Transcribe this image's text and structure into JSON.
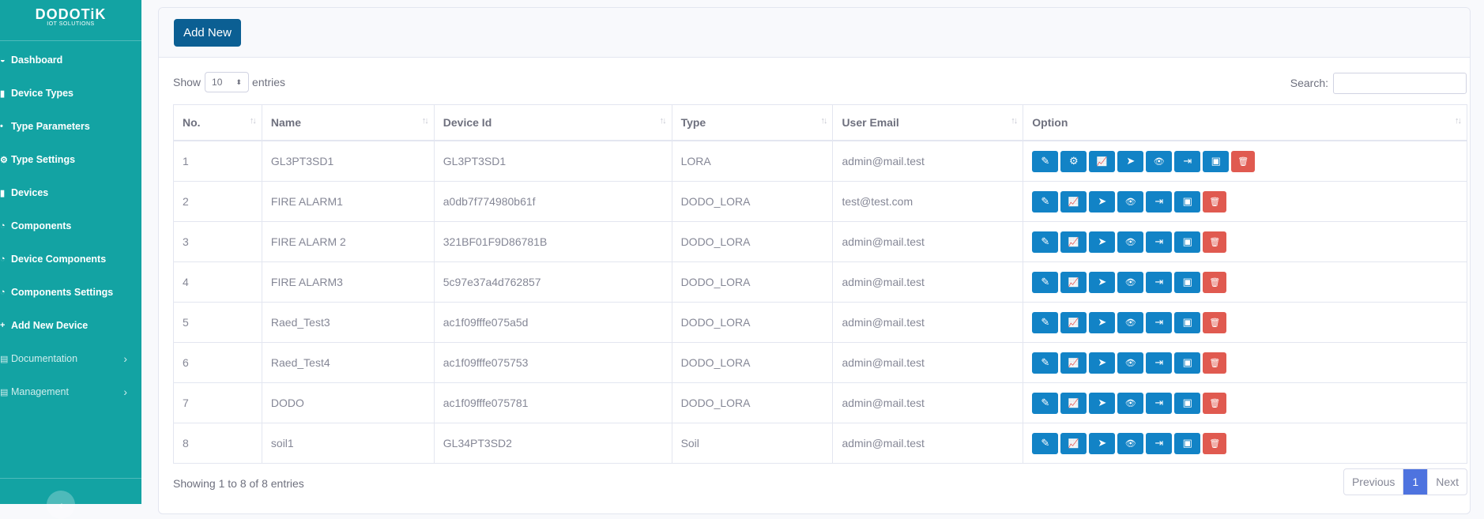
{
  "brand": {
    "name": "DODOTiK",
    "sub": "IOT SOLUTIONS"
  },
  "sidebar": {
    "items": [
      {
        "label": "Dashboard",
        "icon": "dashboard-icon"
      },
      {
        "label": "Device Types",
        "icon": "device-types-icon"
      },
      {
        "label": "Type Parameters",
        "icon": "type-parameters-icon"
      },
      {
        "label": "Type Settings",
        "icon": "gear-icon"
      },
      {
        "label": "Devices",
        "icon": "devices-icon"
      },
      {
        "label": "Components",
        "icon": "components-icon"
      },
      {
        "label": "Device Components",
        "icon": "device-components-icon"
      },
      {
        "label": "Components Settings",
        "icon": "components-settings-icon"
      },
      {
        "label": "Add New Device",
        "icon": "plus-icon"
      },
      {
        "label": "Documentation",
        "icon": "document-icon"
      },
      {
        "label": "Management",
        "icon": "management-icon"
      }
    ],
    "toggle_icon": "chevron-left-icon"
  },
  "toolbar": {
    "add_label": "Add New"
  },
  "table_controls": {
    "show_label": "Show",
    "entries_label": "entries",
    "page_size": "10",
    "search_label": "Search:",
    "search_value": ""
  },
  "table": {
    "headers": [
      "No.",
      "Name",
      "Device Id",
      "Type",
      "User Email",
      "Option"
    ],
    "rows": [
      {
        "no": "1",
        "name": "GL3PT3SD1",
        "device_id": "GL3PT3SD1",
        "type": "LORA",
        "email": "admin@mail.test",
        "options": [
          "edit",
          "settings",
          "chart",
          "locate",
          "view",
          "export",
          "images",
          "delete"
        ]
      },
      {
        "no": "2",
        "name": "FIRE ALARM1",
        "device_id": "a0db7f774980b61f",
        "type": "DODO_LORA",
        "email": "test@test.com",
        "options": [
          "edit",
          "chart",
          "locate",
          "view",
          "export",
          "images",
          "delete"
        ]
      },
      {
        "no": "3",
        "name": "FIRE ALARM 2",
        "device_id": "321BF01F9D86781B",
        "type": "DODO_LORA",
        "email": "admin@mail.test",
        "options": [
          "edit",
          "chart",
          "locate",
          "view",
          "export",
          "images",
          "delete"
        ]
      },
      {
        "no": "4",
        "name": "FIRE ALARM3",
        "device_id": "5c97e37a4d762857",
        "type": "DODO_LORA",
        "email": "admin@mail.test",
        "options": [
          "edit",
          "chart",
          "locate",
          "view",
          "export",
          "images",
          "delete"
        ]
      },
      {
        "no": "5",
        "name": "Raed_Test3",
        "device_id": "ac1f09fffe075a5d",
        "type": "DODO_LORA",
        "email": "admin@mail.test",
        "options": [
          "edit",
          "chart",
          "locate",
          "view",
          "export",
          "images",
          "delete"
        ]
      },
      {
        "no": "6",
        "name": "Raed_Test4",
        "device_id": "ac1f09fffe075753",
        "type": "DODO_LORA",
        "email": "admin@mail.test",
        "options": [
          "edit",
          "chart",
          "locate",
          "view",
          "export",
          "images",
          "delete"
        ]
      },
      {
        "no": "7",
        "name": "DODO",
        "device_id": "ac1f09fffe075781",
        "type": "DODO_LORA",
        "email": "admin@mail.test",
        "options": [
          "edit",
          "chart",
          "locate",
          "view",
          "export",
          "images",
          "delete"
        ]
      },
      {
        "no": "8",
        "name": "soil1",
        "device_id": "GL34PT3SD2",
        "type": "Soil",
        "email": "admin@mail.test",
        "options": [
          "edit",
          "chart",
          "locate",
          "view",
          "export",
          "images",
          "delete"
        ]
      }
    ]
  },
  "footer": {
    "info": "Showing 1 to 8 of 8 entries"
  },
  "pagination": {
    "prev": "Previous",
    "current": "1",
    "next": "Next"
  },
  "colors": {
    "sidebar": "#13a3a3",
    "primary_button": "#1283c6",
    "delete_button": "#e05a50",
    "add_button": "#0b5f93",
    "active_page": "#4e73df"
  }
}
